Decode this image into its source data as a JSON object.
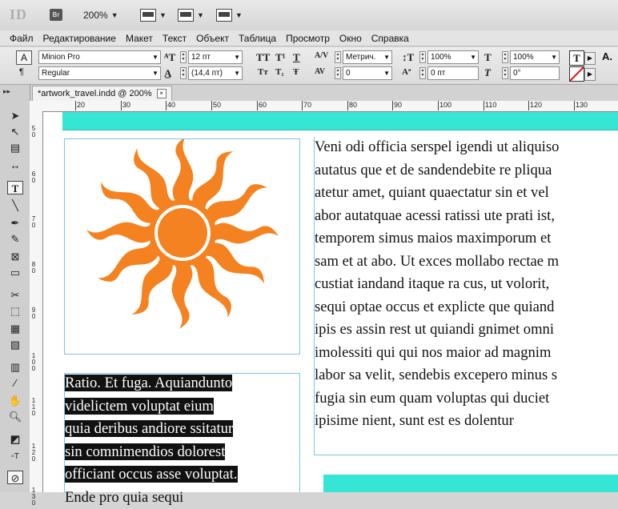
{
  "app": {
    "logo": "ID",
    "bridge": "Br",
    "zoom": "200%"
  },
  "menu": [
    "Файл",
    "Редактирование",
    "Макет",
    "Текст",
    "Объект",
    "Таблица",
    "Просмотр",
    "Окно",
    "Справка"
  ],
  "control": {
    "font_family": "Minion Pro",
    "font_style": "Regular",
    "font_size": "12 пт",
    "leading": "(14,4 пт)",
    "kerning": "Метрич.",
    "tracking": "0",
    "vscale": "100%",
    "hscale": "100%",
    "baseline": "0 пт",
    "skew": "0°",
    "char_icons": [
      "TT",
      "T¹",
      "T",
      "Tт",
      "T₁",
      "Ŧ"
    ]
  },
  "tab": {
    "title": "*artwork_travel.indd @ 200%",
    "close": "×"
  },
  "ruler": {
    "h": [
      "20",
      "30",
      "40",
      "50",
      "60",
      "70",
      "80",
      "90",
      "100",
      "110",
      "120",
      "130"
    ],
    "v": [
      [
        "5",
        "0"
      ],
      [
        "6",
        "0"
      ],
      [
        "7",
        "0"
      ],
      [
        "8",
        "0"
      ],
      [
        "9",
        "0"
      ],
      [
        "1",
        "0",
        "0"
      ],
      [
        "1",
        "1",
        "0"
      ],
      [
        "1",
        "2",
        "0"
      ],
      [
        "1",
        "3",
        "0"
      ]
    ]
  },
  "document": {
    "left_lines": [
      "Ratio. Et fuga. Aquiandunto",
      "videlictem voluptat eium",
      "quia deribus andiore ssitatur",
      "sin comnimendios dolorest",
      "officiant occus asse voluptat.",
      "Ende pro quia sequi"
    ],
    "right_lines": [
      "Veni odi officia serspel igendi ut aliquiso",
      "autatus que et de sandendebite re pliqua",
      "atetur amet, quiant quaectatur sin et vel",
      "abor autatquae acessi ratissi ute prati ist,",
      "temporem simus maios maximporum et",
      "sam et at abo. Ut exces mollabo rectae m",
      "custiat iandand itaque ra cus, ut volorit,",
      "sequi optae occus et explicte que quiand",
      "ipis es assin rest ut quiandi gnimet omni",
      "imolessiti qui qui nos maior ad magnim",
      "labor sa velit, sendebis excepero minus s",
      "fugia sin eum quam voluptas qui duciet",
      "ipisime nient, sunt est es dolentur"
    ]
  },
  "colors": {
    "sun": "#f58220",
    "teal": "#36e6d4",
    "frame": "#7cc4e8"
  }
}
